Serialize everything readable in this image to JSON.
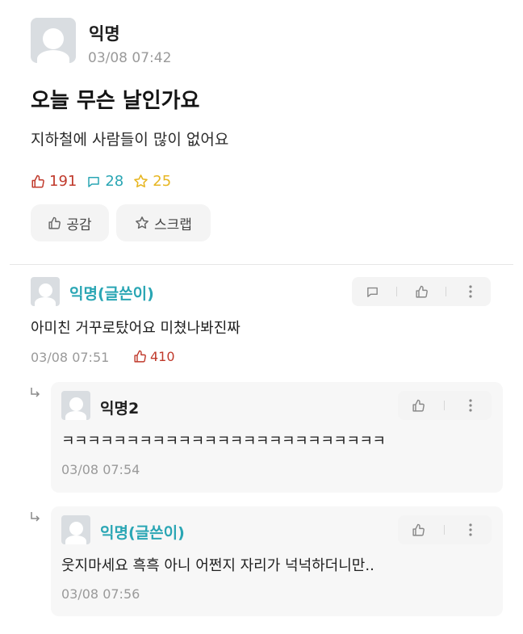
{
  "post": {
    "author": "익명",
    "time": "03/08 07:42",
    "title": "오늘 무슨 날인가요",
    "body": "지하철에 사람들이 많이 없어요",
    "likes": "191",
    "comments": "28",
    "scraps": "25",
    "like_button": "공감",
    "scrap_button": "스크랩"
  },
  "comments": [
    {
      "author": "익명(글쓴이)",
      "text": "아미친 거꾸로탔어요 미쳤나봐진짜",
      "time": "03/08 07:51",
      "likes": "410"
    }
  ],
  "replies": [
    {
      "author": "익명2",
      "text": "ㅋㅋㅋㅋㅋㅋㅋㅋㅋㅋㅋㅋㅋㅋㅋㅋㅋㅋㅋㅋㅋㅋㅋㅋㅋ",
      "time": "03/08 07:54"
    },
    {
      "author": "익명(글쓴이)",
      "text": "웃지마세요 흑흑 아니 어쩐지 자리가 넉넉하더니만..",
      "time": "03/08 07:56"
    }
  ],
  "colors": {
    "op_name": "#2aa6b4",
    "like": "#c0392b",
    "comment": "#2aa6b4",
    "scrap": "#e7b622"
  },
  "icons": [
    "avatar-icon",
    "thumbs-up-icon",
    "speech-bubble-icon",
    "star-icon",
    "more-vertical-icon",
    "reply-arrow-icon"
  ]
}
